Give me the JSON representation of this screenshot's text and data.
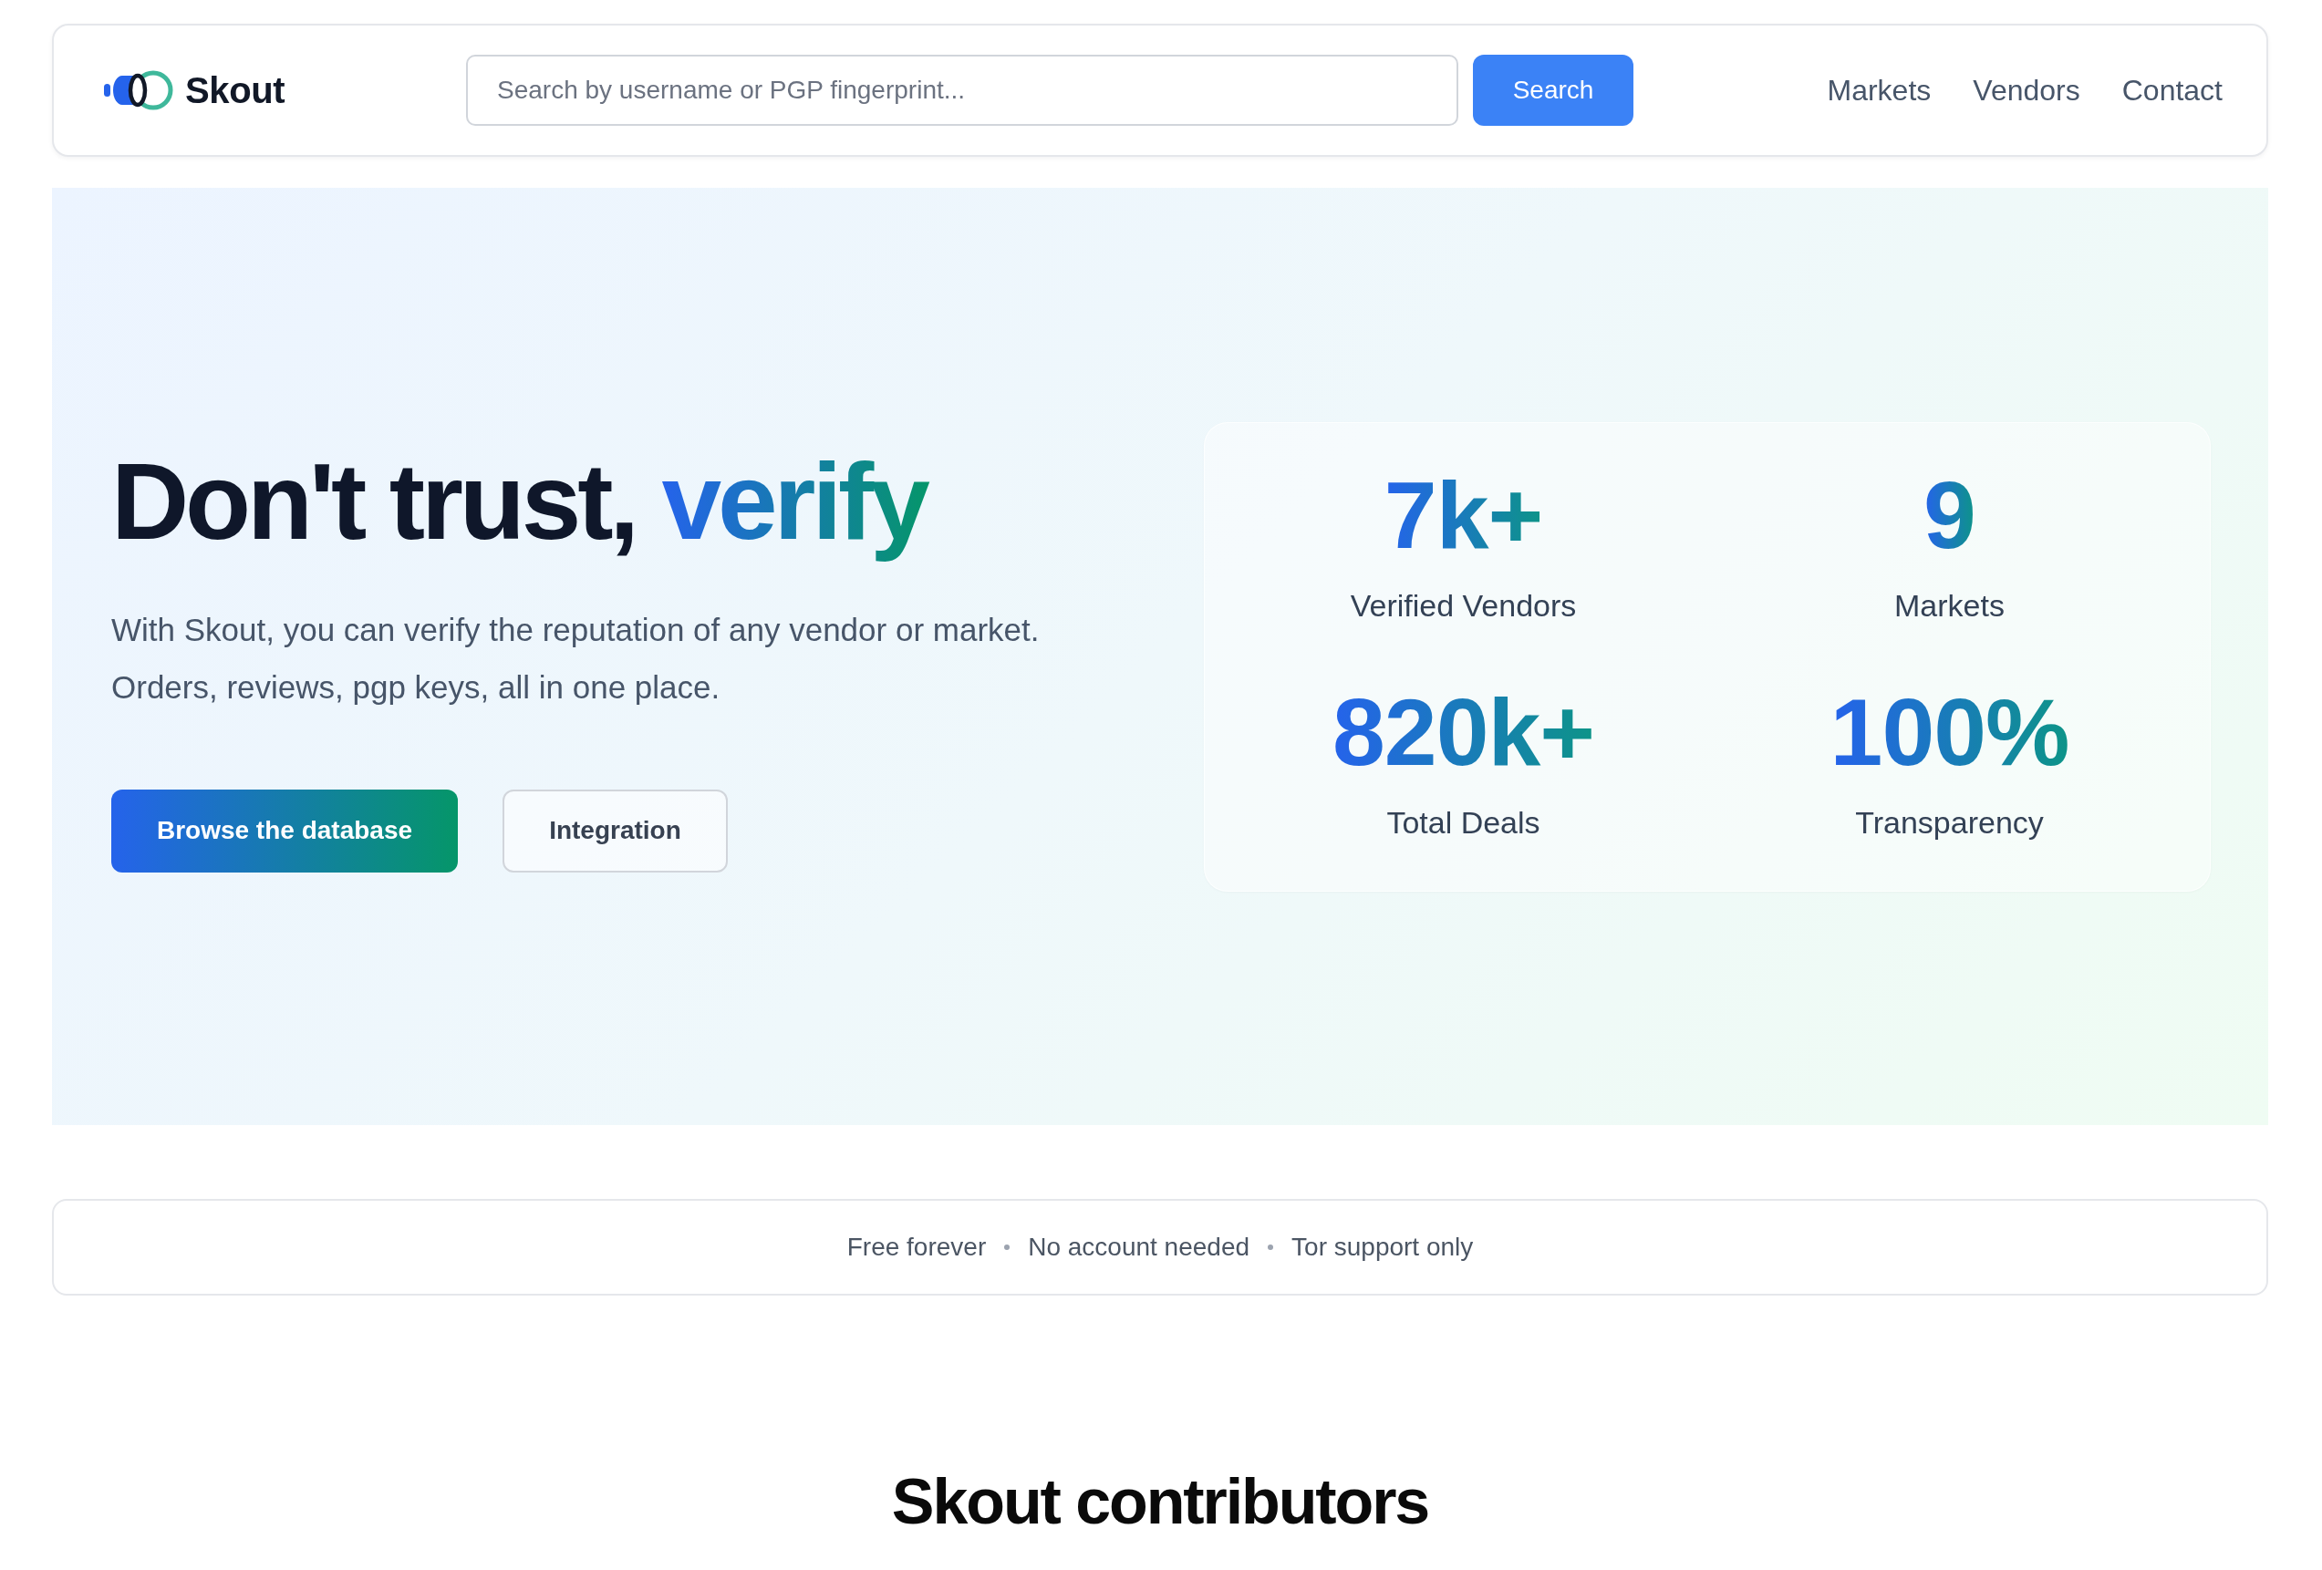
{
  "header": {
    "logo": {
      "text": "Skout"
    },
    "search": {
      "placeholder": "Search by username or PGP fingerprint...",
      "button": "Search"
    },
    "nav": [
      "Markets",
      "Vendors",
      "Contact"
    ]
  },
  "hero": {
    "headline": {
      "text": "Don't trust,",
      "highlight": "verify"
    },
    "description": "With Skout, you can verify the reputation of any vendor or market. Orders, reviews, pgp keys, all in one place.",
    "buttons": [
      {
        "label": "Browse the database",
        "kind": "primary"
      },
      {
        "label": "Integration",
        "kind": "secondary"
      }
    ],
    "stats": [
      {
        "value": "7k+",
        "label": "Verified Vendors"
      },
      {
        "value": "9",
        "label": "Markets"
      },
      {
        "value": "820k+",
        "label": "Total Deals"
      },
      {
        "value": "100%",
        "label": "Transparency"
      }
    ]
  },
  "features": [
    "Free forever",
    "No account needed",
    "Tor support only"
  ],
  "contributors": {
    "title": "Skout contributors"
  }
}
